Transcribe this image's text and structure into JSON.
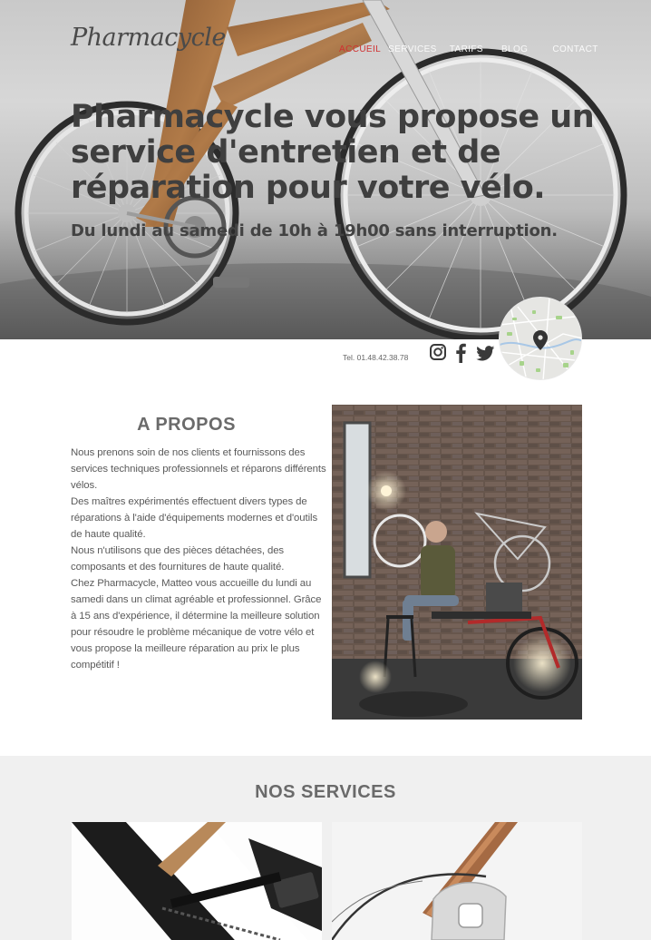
{
  "brand": {
    "logo_text": "Pharmacycle"
  },
  "nav": {
    "items": [
      {
        "label": "ACCUEIL",
        "active": true
      },
      {
        "label": "SERVICES",
        "active": false
      },
      {
        "label": "TARIFS",
        "active": false
      },
      {
        "label": "BLOG",
        "active": false
      },
      {
        "label": "CONTACT",
        "active": false
      }
    ]
  },
  "hero": {
    "headline": "Pharmacycle vous propose un service d'entretien et de réparation pour votre vélo.",
    "subline": "Du lundi au samedi de 10h à 19h00 sans interruption."
  },
  "contact": {
    "phone": "Tel. 01.48.42.38.78",
    "social_icons": [
      "instagram-icon",
      "facebook-icon",
      "twitter-icon"
    ]
  },
  "about": {
    "title": "A PROPOS",
    "paragraphs": [
      "Nous prenons soin de nos clients et fournissons des services techniques professionnels et réparons différents vélos.",
      "Des maîtres expérimentés effectuent divers types de réparations à l'aide d'équipements modernes et d'outils de haute qualité.",
      "Nous n'utilisons que des pièces détachées, des composants et des fournitures de haute qualité.",
      "Chez Pharmacycle, Matteo vous accueille du lundi au samedi dans un climat agréable et professionnel. Grâce à 15 ans d'expérience, il détermine la meilleure solution pour résoudre le problème mécanique de votre vélo et vous propose la meilleure réparation au prix le plus compétitif !"
    ]
  },
  "services": {
    "title": "NOS SERVICES"
  },
  "colors": {
    "accent": "#d13030",
    "services_bg": "#f0f0f0"
  }
}
